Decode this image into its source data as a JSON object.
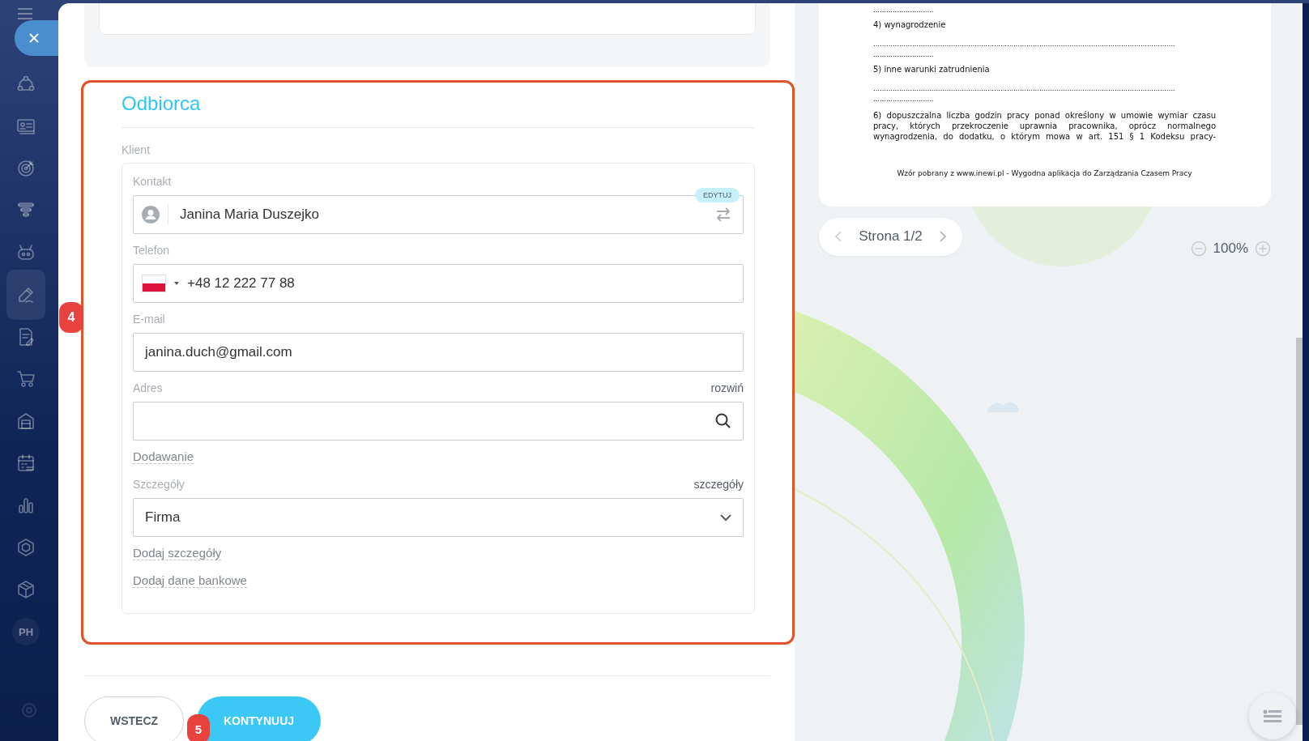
{
  "sidebar": {
    "items": [
      {
        "selected": false
      },
      {
        "selected": false
      },
      {
        "selected": false
      },
      {
        "selected": false
      },
      {
        "selected": false
      },
      {
        "selected": true
      },
      {
        "selected": false
      },
      {
        "selected": false
      },
      {
        "selected": false
      },
      {
        "selected": false
      },
      {
        "selected": false
      },
      {
        "selected": false
      },
      {
        "selected": false
      },
      {
        "label": "PH",
        "selected": false
      }
    ]
  },
  "recipient": {
    "title": "Odbiorca",
    "highlighted": true,
    "annotation": "4",
    "client_label": "Klient",
    "fields": [
      {
        "kind": "contact",
        "label": "Kontakt",
        "value": "Janina Maria Duszejko",
        "badge": "EDYTUJ"
      },
      {
        "kind": "phone",
        "label": "Telefon",
        "value": "+48 12 222 77 88"
      },
      {
        "kind": "text",
        "label": "E-mail",
        "value": "janina.duch@gmail.com"
      },
      {
        "kind": "search",
        "label": "Adres",
        "action": "rozwiń"
      },
      {
        "kind": "link",
        "label": "Dodawanie"
      },
      {
        "kind": "select",
        "label": "Szczegóły",
        "action": "szczegóły",
        "value": "Firma"
      },
      {
        "kind": "link",
        "label": "Dodaj szczegóły"
      },
      {
        "kind": "link",
        "label": "Dodaj dane bankowe"
      }
    ]
  },
  "buttons": [
    {
      "kind": "secondary",
      "label": "WSTECZ"
    },
    {
      "kind": "primary",
      "label": "KONTYNUUJ",
      "annotation": "5"
    }
  ],
  "document": {
    "lines": [
      {
        "kind": "dots",
        "text": "............................"
      },
      {
        "kind": "text",
        "text": "4) wynagrodzenie"
      },
      {
        "kind": "dots",
        "text": "............................................................................................................................................"
      },
      {
        "kind": "dots",
        "text": "............................"
      },
      {
        "kind": "text",
        "text": "5) inne warunki zatrudnienia"
      },
      {
        "kind": "dots",
        "text": "............................................................................................................................................"
      },
      {
        "kind": "dots",
        "text": "............................"
      },
      {
        "kind": "paragraph",
        "text": "6) dopuszczalna liczba godzin pracy ponad określony w umowie wymiar czasu pracy, których przekroczenie uprawnia pracownika, oprócz normalnego wynagrodzenia, do dodatku, o którym mowa w art. 151 § 1 Kodeksu pracy-"
      },
      {
        "kind": "footer",
        "text": "Wzór pobrany z www.inewi.pl - Wygodna aplikacja do Zarządzania Czasem Pracy"
      }
    ],
    "pager": "Strona 1/2",
    "zoom": "100%"
  }
}
